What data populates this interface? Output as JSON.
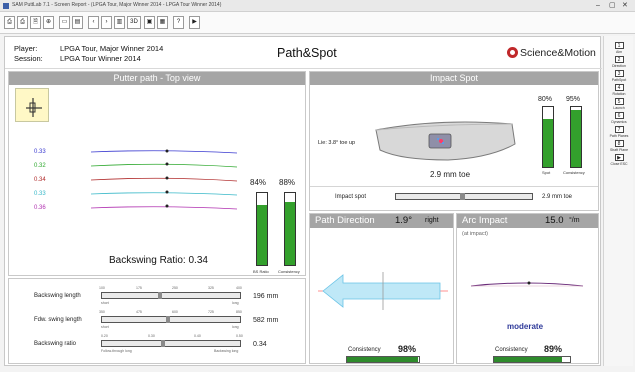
{
  "window": {
    "title": "SAM PuttLab 7.1 - Screen Report - (LPGA Tour, Major Winner 2014 - LPGA Tour Winner 2014)",
    "controls": [
      "–",
      "▢",
      "✕"
    ]
  },
  "toolbar": {
    "buttons": [
      "⎙",
      "⎙",
      "🗎",
      "⊕",
      "▭",
      "▤",
      "‹",
      "›",
      "▥",
      "3D",
      "▣",
      "▦",
      "?",
      "▶"
    ]
  },
  "header": {
    "player_label": "Player:",
    "player_value": "LPGA Tour, Major Winner 2014",
    "session_label": "Session:",
    "session_value": "LPGA Tour Winner 2014",
    "page_title": "Path&Spot",
    "brand_name": "Science&Motion"
  },
  "putter_path": {
    "title": "Putter path - Top view",
    "offsets": [
      "0.33",
      "0.32",
      "0.34",
      "0.33",
      "0.36"
    ],
    "offset_colors": [
      "#3a3ad0",
      "#2ea82e",
      "#b02a2a",
      "#38b8c8",
      "#b030b0"
    ],
    "bars": [
      {
        "label": "84%",
        "caption": "BS Ratio",
        "value": 0.84
      },
      {
        "label": "88%",
        "caption": "Consistency",
        "value": 0.88
      }
    ],
    "ratio_text": "Backswing Ratio: 0.34"
  },
  "swing_metrics": [
    {
      "label": "Backswing length",
      "value": "196 mm",
      "left_hint": "short",
      "right_hint": "long",
      "ticks": [
        "100",
        "175",
        "250",
        "325",
        "400"
      ],
      "marker": 0.42
    },
    {
      "label": "Fdw. swing length",
      "value": "582 mm",
      "left_hint": "short",
      "right_hint": "long",
      "ticks": [
        "350",
        "475",
        "600",
        "725",
        "850"
      ],
      "marker": 0.48
    },
    {
      "label": "Backswing ratio",
      "value": "0.34",
      "left_hint": "Follow-through long",
      "right_hint": "Backswing long",
      "ticks": [
        "0.20",
        "0.30",
        "0.40",
        "0.50"
      ],
      "marker": 0.44
    }
  ],
  "impact_spot": {
    "title": "Impact Spot",
    "lie_text": "Lie: 3.8° toe up",
    "toe_value": "2.9 mm toe",
    "bars": [
      {
        "label": "80%",
        "caption": "Spot",
        "value": 0.8
      },
      {
        "label": "95%",
        "caption": "Consistency",
        "value": 0.95
      }
    ],
    "scale_label": "Impact spot",
    "scale_value": "2.9 mm toe"
  },
  "path_direction": {
    "title": "Path Direction",
    "value": "1.9°",
    "unit": "right",
    "consistency_label": "Consistency",
    "consistency_value": "98%",
    "consistency": 0.98
  },
  "arc_impact": {
    "title": "Arc Impact",
    "value": "15.0",
    "unit": "°/m",
    "subtitle": "(at impact)",
    "arc_label": "moderate",
    "consistency_label": "Consistency",
    "consistency_value": "89%",
    "consistency": 0.89
  },
  "sidebar": {
    "items": [
      {
        "num": "1",
        "label": "Aim"
      },
      {
        "num": "2",
        "label": "Direction"
      },
      {
        "num": "3",
        "label": "PathSpot"
      },
      {
        "num": "4",
        "label": "Rotation"
      },
      {
        "num": "5",
        "label": "Launch"
      },
      {
        "num": "6",
        "label": "Dynamics"
      },
      {
        "num": "7",
        "label": "Path Planes"
      },
      {
        "num": "8",
        "label": "Shaft Plane"
      },
      {
        "num": "▶",
        "label": "Close ESC"
      }
    ]
  }
}
